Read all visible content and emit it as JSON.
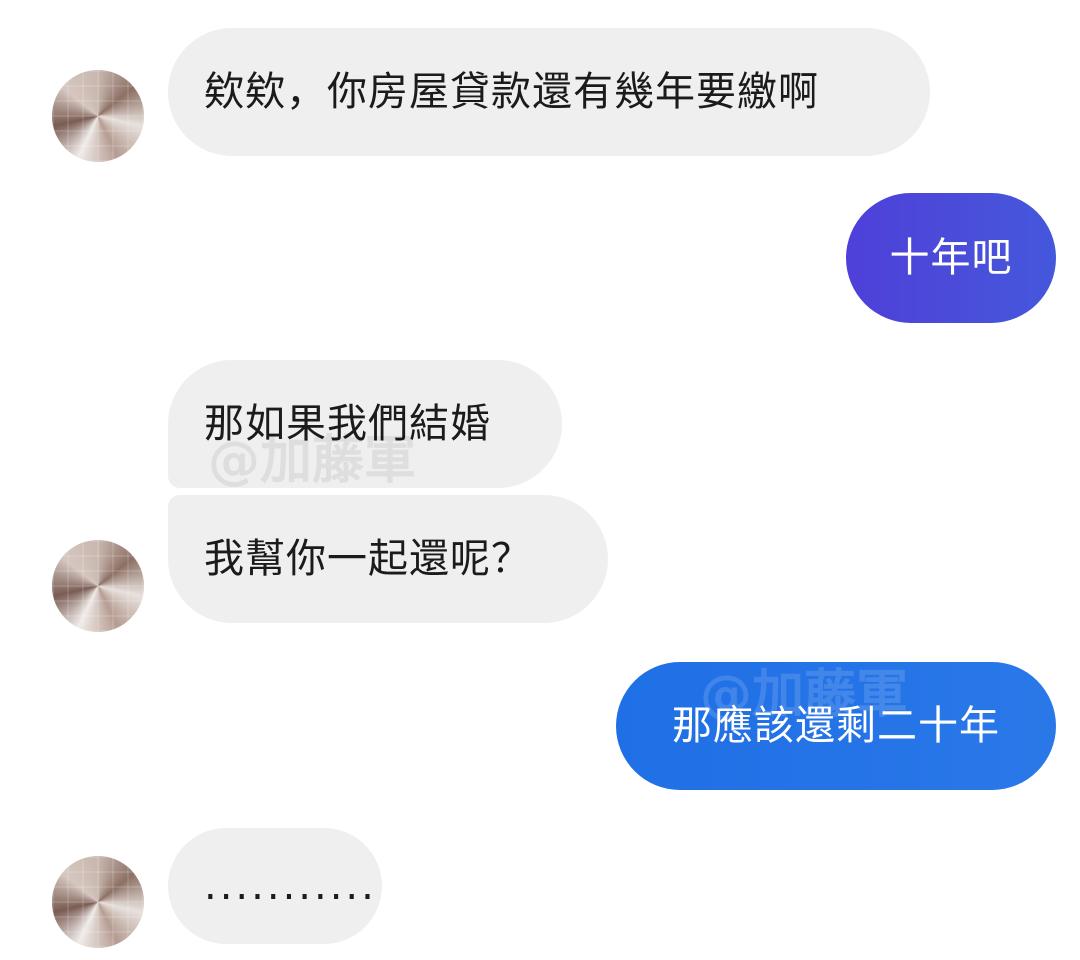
{
  "messages": [
    {
      "from": "contact",
      "text": "欸欸，你房屋貸款還有幾年要繳啊"
    },
    {
      "from": "me",
      "text": "十年吧"
    },
    {
      "from": "contact",
      "text": "那如果我們結婚"
    },
    {
      "from": "contact",
      "text": "我幫你一起還呢？"
    },
    {
      "from": "me",
      "text": "那應該還剩二十年"
    },
    {
      "from": "contact",
      "text": "..........."
    }
  ],
  "watermark": "@加藤軍",
  "colors": {
    "incoming_bubble": "#efefef",
    "outgoing_bubble_purple": "#4a4ed9",
    "outgoing_bubble_blue": "#2a78e8",
    "text_dark": "#1b1b1b",
    "text_light": "#ffffff"
  },
  "icons": [
    "contact-avatar-icon"
  ]
}
